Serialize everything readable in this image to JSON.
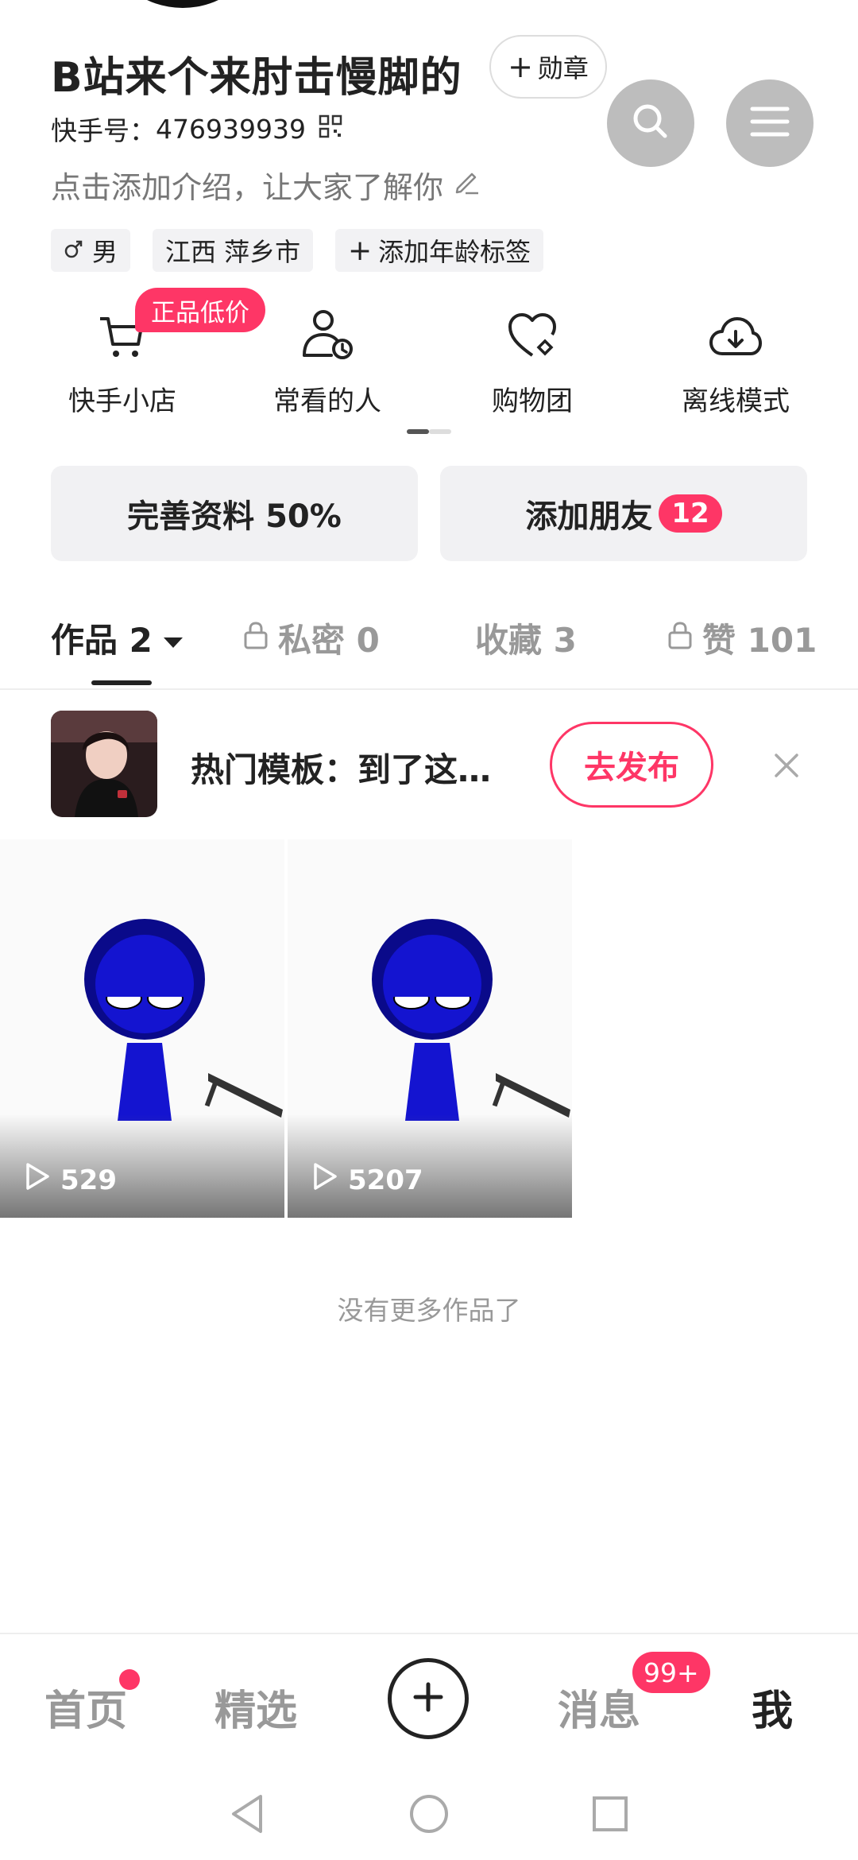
{
  "profile": {
    "name": "B站来个来肘击慢脚的",
    "medal_label": "勋章",
    "kuaishou_id_label": "快手号：",
    "kuaishou_id": "476939939",
    "intro_placeholder": "点击添加介绍，让大家了解你",
    "tags": {
      "gender": "男",
      "location": "江西 萍乡市",
      "add_age": "添加年龄标签"
    }
  },
  "shortcuts": [
    {
      "label": "快手小店",
      "icon": "cart-icon"
    },
    {
      "label": "常看的人",
      "icon": "person-clock-icon"
    },
    {
      "label": "购物团",
      "icon": "heart-bag-icon"
    },
    {
      "label": "离线模式",
      "icon": "cloud-download-icon"
    }
  ],
  "promo_badge": "正品低价",
  "actions": {
    "complete_profile": "完善资料 50%",
    "add_friends": "添加朋友",
    "add_friends_count": "12"
  },
  "tabs": {
    "works": "作品 2",
    "private": "私密 0",
    "favorites": "收藏 3",
    "likes": "赞 101"
  },
  "template": {
    "text": "热门模板：到了这…",
    "publish": "去发布"
  },
  "videos": [
    {
      "plays": "529"
    },
    {
      "plays": "5207"
    }
  ],
  "no_more": "没有更多作品了",
  "bottom_nav": {
    "home": "首页",
    "featured": "精选",
    "messages": "消息",
    "messages_badge": "99+",
    "me": "我"
  },
  "colors": {
    "accent": "#fe3666",
    "text": "#222222",
    "muted": "#999999"
  }
}
